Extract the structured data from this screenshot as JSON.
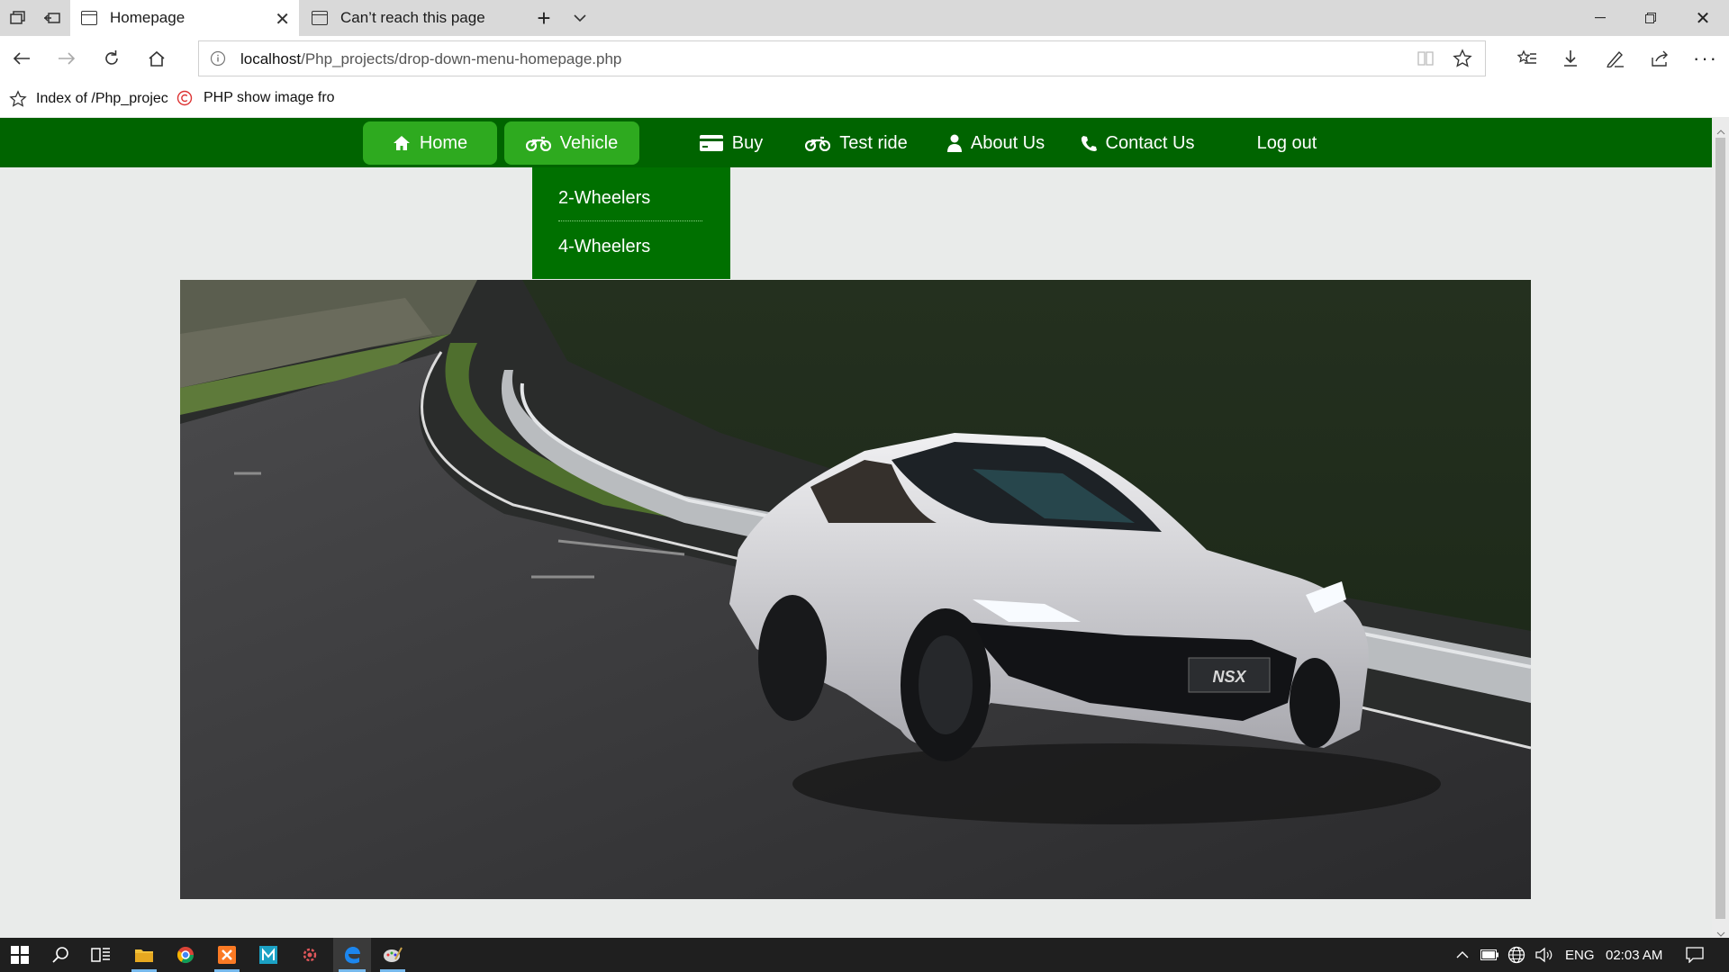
{
  "browser": {
    "tabs": [
      {
        "title": "Homepage",
        "active": true
      },
      {
        "title": "Can’t reach this page",
        "active": false
      }
    ],
    "address": {
      "host": "localhost",
      "path": "/Php_projects/drop-down-menu-homepage.php"
    },
    "favorites": [
      {
        "label": "Index of /Php_projec",
        "icon": "star-outline-icon"
      },
      {
        "label": "PHP show image fro",
        "icon": "copyright-c-icon"
      }
    ]
  },
  "site": {
    "nav": [
      {
        "label": "Home",
        "icon": "home-icon",
        "highlighted": true
      },
      {
        "label": "Vehicle",
        "icon": "motorcycle-icon",
        "highlighted": true
      },
      {
        "label": "Buy",
        "icon": "credit-card-icon",
        "highlighted": false
      },
      {
        "label": "Test ride",
        "icon": "motorcycle-icon",
        "highlighted": false
      },
      {
        "label": "About Us",
        "icon": "user-icon",
        "highlighted": false
      },
      {
        "label": "Contact Us",
        "icon": "phone-icon",
        "highlighted": false
      },
      {
        "label": "Log out",
        "icon": "",
        "highlighted": false
      }
    ],
    "dropdown": {
      "items": [
        {
          "label": "2-Wheelers"
        },
        {
          "label": "4-Wheelers"
        }
      ]
    },
    "hero": {
      "plate": "NSX"
    }
  },
  "taskbar": {
    "lang": "ENG",
    "time": "02:03 AM"
  },
  "colors": {
    "nav_bg": "#006400",
    "nav_highlight": "#2eaa1f",
    "page_bg": "#e9ebea",
    "dropdown_bg": "#007000"
  }
}
